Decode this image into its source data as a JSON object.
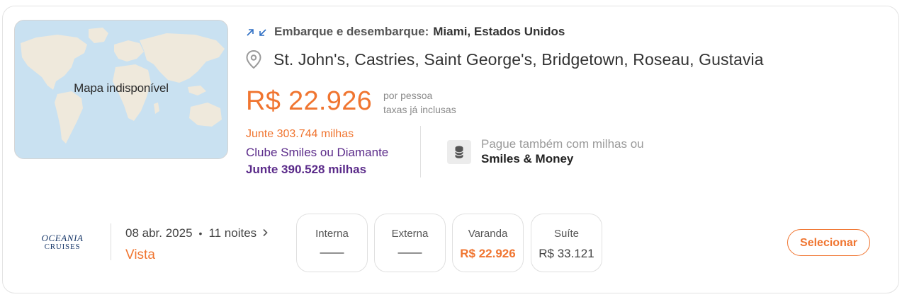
{
  "map": {
    "unavailable_label": "Mapa indisponível"
  },
  "itinerary": {
    "embark_label": "Embarque e desembarque:",
    "embark_value": "Miami, Estados Unidos",
    "ports": "St. John's, Castries, Saint George's, Bridgetown, Roseau, Gustavia"
  },
  "pricing": {
    "price": "R$ 22.926",
    "note_line1": "por pessoa",
    "note_line2": "taxas já inclusas",
    "miles_line1": "Junte 303.744 milhas",
    "miles_line2": "Clube Smiles ou Diamante",
    "miles_line3": "Junte 390.528 milhas",
    "pay_line1": "Pague também com milhas ou",
    "pay_line2": "Smiles & Money"
  },
  "cruise": {
    "logo_line1": "OCEANIA",
    "logo_line2": "CRUISES",
    "date": "08 abr. 2025",
    "separator": "•",
    "nights": "11 noites",
    "ship": "Vista"
  },
  "cabins": [
    {
      "name": "Interna",
      "price": "——"
    },
    {
      "name": "Externa",
      "price": "——"
    },
    {
      "name": "Varanda",
      "price": "R$ 22.926"
    },
    {
      "name": "Suíte",
      "price": "R$ 33.121"
    }
  ],
  "actions": {
    "select_label": "Selecionar"
  },
  "colors": {
    "accent_orange": "#f07530",
    "smiles_purple": "#5b2b8a",
    "arrow_blue": "#2f6fc4"
  },
  "icons": [
    "embark-arrow-icon",
    "disembark-arrow-icon",
    "location-pin-icon",
    "coins-icon",
    "chevron-right-icon"
  ]
}
